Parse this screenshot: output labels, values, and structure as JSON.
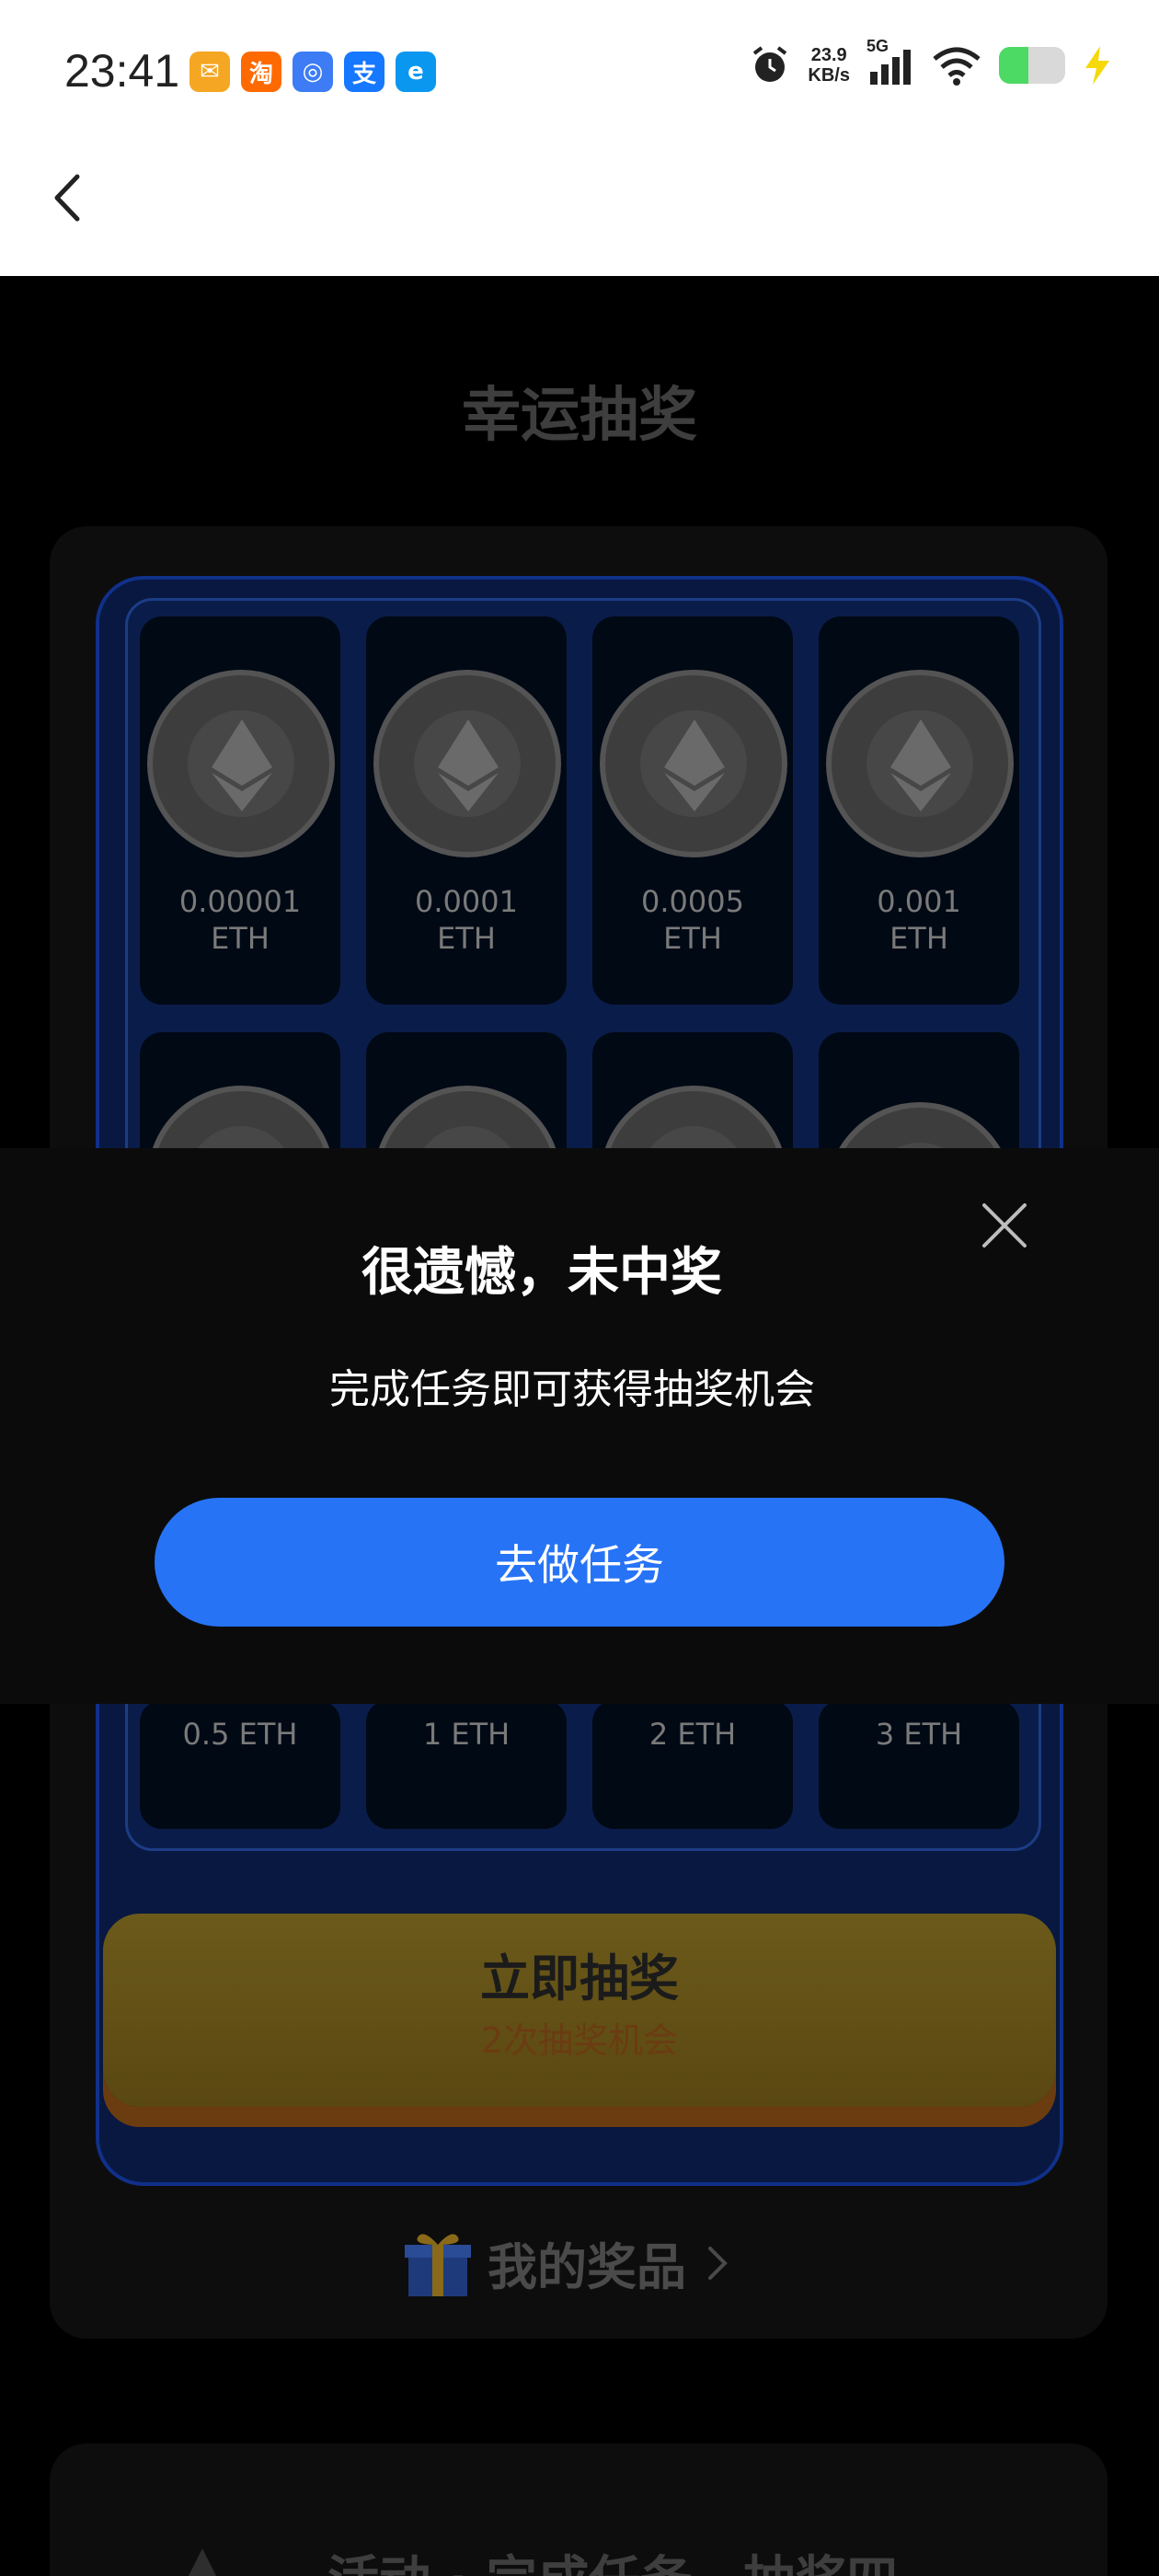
{
  "status_bar": {
    "time": "23:41",
    "net_speed_value": "23.9",
    "net_speed_unit": "KB/s",
    "network_type": "5G",
    "battery_level": 0.45,
    "notification_icons": [
      {
        "name": "mail-app-icon",
        "glyph": "✉",
        "color": "#f5a623"
      },
      {
        "name": "taobao-app-icon",
        "glyph": "淘",
        "color": "#ff6a00"
      },
      {
        "name": "browser-app-icon",
        "glyph": "◎",
        "color": "#3d7cf5"
      },
      {
        "name": "alipay-app-icon",
        "glyph": "支",
        "color": "#1677ff"
      },
      {
        "name": "eleme-app-icon",
        "glyph": "e",
        "color": "#0a97f0"
      }
    ]
  },
  "nav": {
    "back_icon": "chevron-left-icon"
  },
  "page": {
    "title": "幸运抽奖"
  },
  "prizes_top": [
    {
      "amount": "0.00001",
      "unit": "ETH"
    },
    {
      "amount": "0.0001",
      "unit": "ETH"
    },
    {
      "amount": "0.0005",
      "unit": "ETH"
    },
    {
      "amount": "0.001",
      "unit": "ETH"
    }
  ],
  "prizes_bottom": [
    "0.5 ETH",
    "1 ETH",
    "2 ETH",
    "3 ETH"
  ],
  "draw_button": {
    "label": "立即抽奖",
    "chances": "2次抽奖机会"
  },
  "my_prizes": {
    "label": "我的奖品"
  },
  "task_section": {
    "text": "活动 · 完成任务，抽奖四"
  },
  "modal": {
    "title": "很遗憾，未中奖",
    "message": "完成任务即可获得抽奖机会",
    "button_label": "去做任务"
  },
  "colors": {
    "accent_blue": "#2773f6",
    "machine_blue": "#10308a",
    "gold": "#6b5a1a"
  }
}
